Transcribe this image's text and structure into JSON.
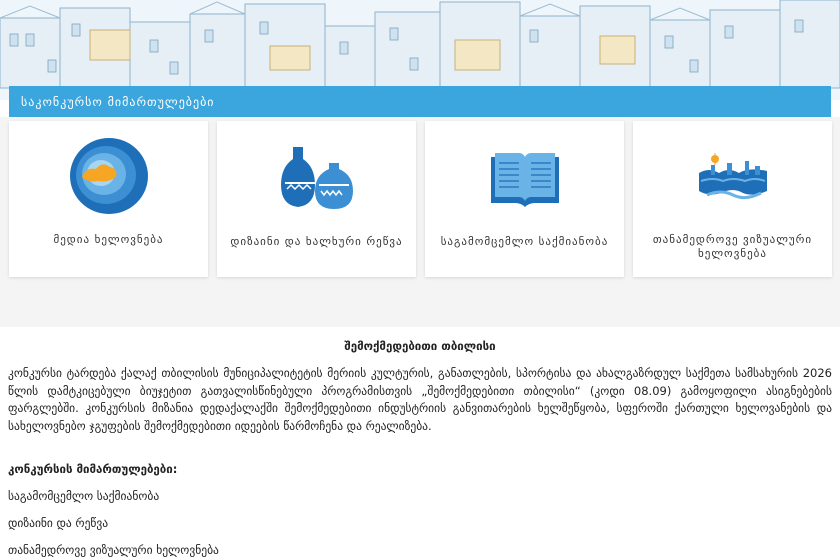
{
  "banner": {
    "alt_icon": "tbilisi-houses-illustration"
  },
  "categories_header": "საკონკურსო მიმართულებები",
  "cards": [
    {
      "label": "მედია ხელოვნება",
      "icon": "media-art-icon"
    },
    {
      "label": "დიზაინი და ხალხური რეწვა",
      "icon": "pottery-icon"
    },
    {
      "label": "საგამომცემლო საქმიანობა",
      "icon": "open-book-icon"
    },
    {
      "label": "თანამედროვე ვიზუალური ხელოვნება",
      "icon": "city-skyline-icon"
    }
  ],
  "article": {
    "title": "შემოქმედებითი თბილისი",
    "paragraph": "კონკურსი ტარდება ქალაქ თბილისის მუნიციპალიტეტის მერიის კულტურის, განათლების, სპორტისა და ახალგაზრდულ საქმეთა სამსახურის 2026 წლის დამტკიცებული ბიუჯეტით გათვალისწინებული პროგრამისთვის „შემოქმედებითი თბილისი“ (კოდი 08.09) გამოყოფილი ასიგნებების ფარგლებში. კონკურსის მიზანია დედაქალაქში შემოქმედებითი ინდუსტრიის განვითარების ხელშეწყობა, სფეროში ქართული ხელოვანების და სახელოვნებო ჯგუფების შემოქმედებითი იდეების წარმოჩენა და რეალიზება.",
    "directions_heading": "კონკურსის მიმართულებები:",
    "directions": [
      "საგამომცემლო საქმიანობა",
      "დიზაინი და რეწვა",
      "თანამედროვე ვიზუალური ხელოვნება"
    ]
  },
  "colors": {
    "accent": "#3aa6dd",
    "icon_blue": "#1e6fb8",
    "icon_orange": "#f6a623"
  }
}
